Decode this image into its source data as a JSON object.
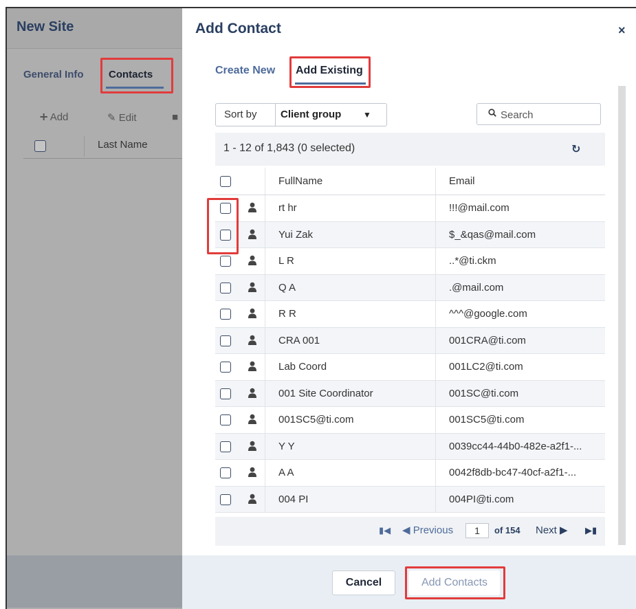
{
  "background": {
    "title": "New Site",
    "tabs": [
      {
        "label": "General Info"
      },
      {
        "label": "Contacts"
      }
    ],
    "toolbar": {
      "add_label": "Add",
      "edit_label": "Edit"
    },
    "table_header": {
      "last_name": "Last Name"
    }
  },
  "modal": {
    "title": "Add Contact",
    "close_label": "×",
    "tabs": [
      {
        "label": "Create New"
      },
      {
        "label": "Add Existing"
      }
    ],
    "sort": {
      "label": "Sort by",
      "value": "Client group"
    },
    "search": {
      "placeholder": "Search"
    },
    "list_status": "1 - 12 of 1,843 (0 selected)",
    "columns": {
      "full_name": "FullName",
      "email": "Email"
    },
    "rows": [
      {
        "full_name": "rt hr",
        "email": "!!!@mail.com"
      },
      {
        "full_name": "Yui Zak",
        "email": "$_&qas@mail.com"
      },
      {
        "full_name": "L R",
        "email": "..*@ti.ckm"
      },
      {
        "full_name": "Q A",
        "email": ".@mail.com"
      },
      {
        "full_name": "R R",
        "email": "^^^@google.com"
      },
      {
        "full_name": "CRA 001",
        "email": "001CRA@ti.com"
      },
      {
        "full_name": "Lab Coord",
        "email": "001LC2@ti.com"
      },
      {
        "full_name": "001 Site Coordinator",
        "email": "001SC@ti.com"
      },
      {
        "full_name": "001SC5@ti.com",
        "email": "001SC5@ti.com"
      },
      {
        "full_name": "Y Y",
        "email": "0039cc44-44b0-482e-a2f1-..."
      },
      {
        "full_name": "A A",
        "email": "0042f8db-bc47-40cf-a2f1-..."
      },
      {
        "full_name": "004 PI",
        "email": "004PI@ti.com"
      }
    ],
    "pager": {
      "previous_label": "Previous",
      "page": "1",
      "of_label": "of 154",
      "next_label": "Next"
    },
    "footer": {
      "cancel_label": "Cancel",
      "add_label": "Add Contacts"
    }
  },
  "colors": {
    "accent": "#4e6b9b",
    "title": "#2a3f61",
    "highlight": "#e23b3b"
  }
}
